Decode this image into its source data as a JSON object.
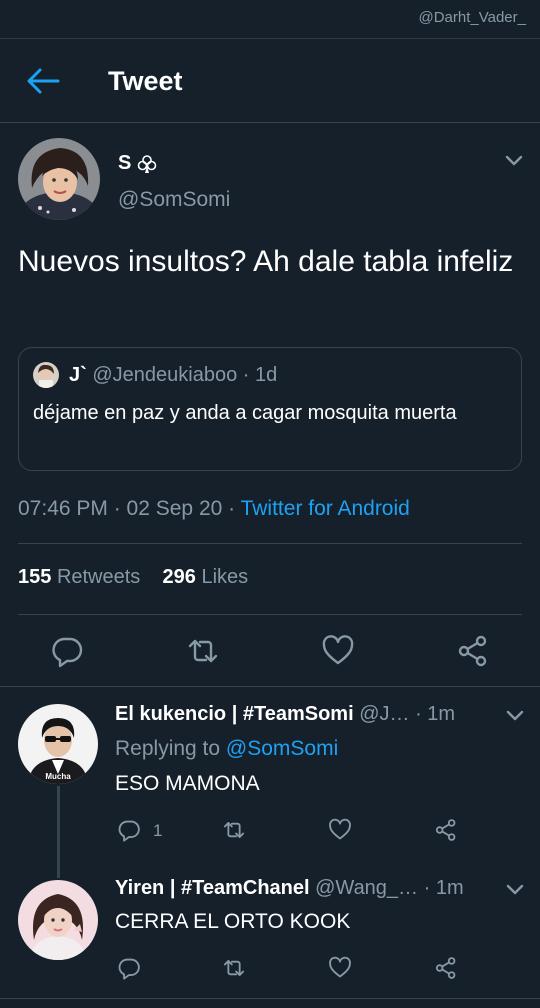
{
  "watermark": "@Darht_Vader_",
  "header": {
    "title": "Tweet"
  },
  "tweet": {
    "author_name": "S",
    "author_handle": "@SomSomi",
    "text": "Nuevos insultos? Ah dale tabla infeliz",
    "quote": {
      "name": "J`",
      "handle": "@Jendeukiaboo · 1d",
      "text": "déjame en paz y anda a cagar mosquita muerta"
    },
    "time": "07:46 PM · 02 Sep 20 · ",
    "source": "Twitter for Android",
    "retweets_count": "155",
    "retweets_label": "Retweets",
    "likes_count": "296",
    "likes_label": "Likes"
  },
  "replies": [
    {
      "name": "El kukencio | #TeamSomi",
      "handle": "@J…",
      "time": "· 1m",
      "replying_label": "Replying to ",
      "replying_to": "@SomSomi",
      "avatar_caption": "Mucha",
      "text": "ESO MAMONA",
      "reply_count": "1"
    },
    {
      "name": "Yiren | #TeamChanel",
      "handle": "@Wang_…",
      "time": "· 1m",
      "text": "CERRA EL ORTO KOOK"
    }
  ],
  "colors": {
    "background": "#15202b",
    "accent": "#1da1f2",
    "muted": "#8899a6",
    "divider": "#38444d"
  },
  "icons": [
    "back-arrow-icon",
    "club-suit-icon",
    "chevron-down-icon",
    "reply-icon",
    "retweet-icon",
    "like-icon",
    "share-icon"
  ]
}
